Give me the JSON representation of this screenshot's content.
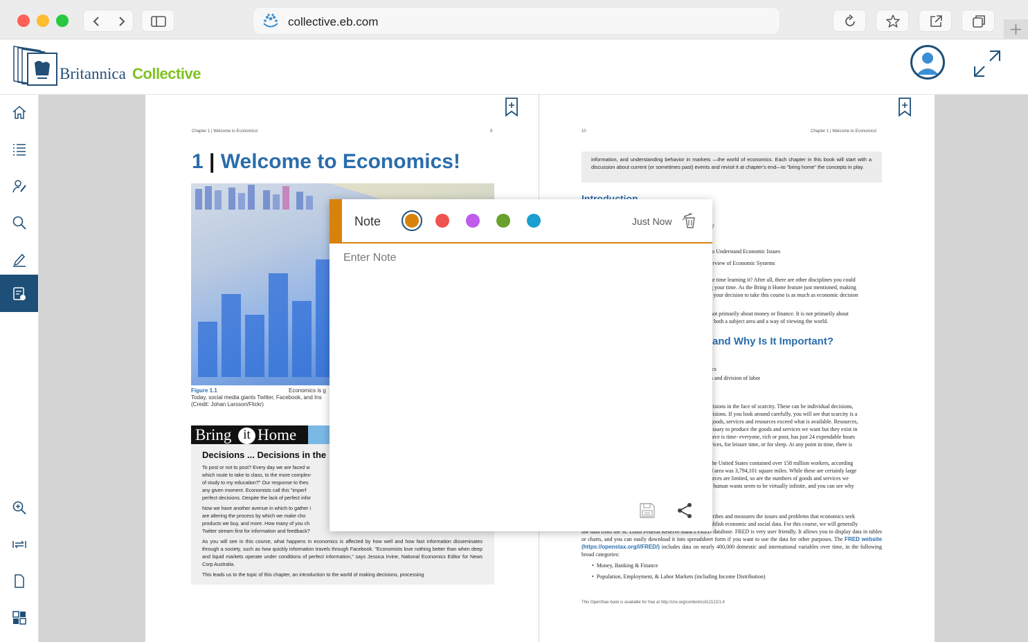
{
  "browser": {
    "url": "collective.eb.com"
  },
  "app": {
    "brand_name": "Britannica",
    "brand_product": "Collective"
  },
  "sidebar": {
    "items": [
      {
        "name": "home",
        "icon": "home-icon"
      },
      {
        "name": "contents",
        "icon": "list-icon"
      },
      {
        "name": "activity",
        "icon": "person-pen-icon"
      },
      {
        "name": "search",
        "icon": "search-icon"
      },
      {
        "name": "annotate",
        "icon": "pencil-icon"
      },
      {
        "name": "notes",
        "icon": "notes-icon",
        "active": true
      },
      {
        "name": "zoom",
        "icon": "zoom-in-icon"
      },
      {
        "name": "fit-width",
        "icon": "fit-width-icon"
      },
      {
        "name": "single-page",
        "icon": "page-icon"
      },
      {
        "name": "thumbnails",
        "icon": "grid-icon"
      }
    ]
  },
  "left_page": {
    "running_head": "Chapter 1 | Welcome to Economics!",
    "page_number": "9",
    "chapter_number": "1",
    "chapter_title": "Welcome to Economics!",
    "figure_label": "Figure 1.1",
    "figure_caption_1": "Economics is g",
    "figure_caption_2": "Today, social media giants Twitter, Facebook, and Ins",
    "figure_credit": "(Credit: Johan Larsson/Flickr)",
    "feature_banner_1": "Bring",
    "feature_banner_2": "it",
    "feature_banner_3": "Home",
    "feature_heading": "Decisions ... Decisions in the",
    "feature_paragraphs": [
      "To post or not to post? Every day we are faced w",
      "which route to take to class, to the more complex-",
      "of study to my education?\" Our response to thes",
      "any given moment. Economists call this \"imperf",
      "perfect decisions. Despite the lack of perfect infor",
      "Now we have another avenue in which to gather i",
      "are altering the process by which we make cho",
      "products we buy, and more. How many of you ch",
      "Twitter stream first for information and feedback?"
    ],
    "feature_full_para_1": "As you will see in this course, what happens in economics is affected by how well and how fast information disseminates through a society, such as how quickly information travels through Facebook. \"Economists love nothing better than when deep and liquid markets operate under conditions of perfect information,\" says Jessica Irvine, National Economics Editor for News Corp Australia.",
    "feature_full_para_2": "This leads us to the topic of this chapter, an introduction to the world of making decisions, processing"
  },
  "right_page": {
    "page_number": "10",
    "running_head": "Chapter 1 | Welcome to Economics!",
    "intro_text": "information, and understanding behavior in markets —the world of economics. Each chapter in this book will start with a discussion about current (or sometimes past) events and revisit it at chapter's end—to \"bring home\" the concepts in play.",
    "section_heading": "Introduction",
    "visible_fragments": [
      "t?",
      "to Understand Economic Issues",
      "erview of Economic Systems",
      "ur time learning it? After all, there are other disciplines you could",
      "g your time. As the Bring it Home feature just mentioned, making",
      "l your decision to take this course is as much as economic decision",
      "not primarily about money or finance. It is not primarily about",
      "s both a subject area and a way of viewing the world.",
      "ics",
      "n and division of labor",
      "cisions in the face of scarcity. These can be individual decisions,",
      "cisions. If you look around carefully, you will see that scarcity is a",
      "goods, services and resources exceed what is available. Resources,",
      "essary to produce the goods and services we want but they exist in",
      "urce is time- everyone, rich or poor, has just 24 expendable hours",
      "vices, for leisure time, or for sleep. At any point in time, there is",
      "the United States contained over 158 million workers, according",
      "d area was 3,794,101 square miles. While these are certainly large",
      "urces are limited, so are the numbers of goods and services we",
      "t human wants seem to be virtually infinite, and you can see why",
      "cribes and measures the issues and problems that economics seek",
      "ublish economic and social data. For this course, we will generally"
    ],
    "section_heading_2": "and Why Is It Important?",
    "bottom_line_1": "use data from the St. Louis Federal Reserve Bank's FRED database. FRED is very user friendly. It allows you to display data in tables or charts, and you can easily download it into spreadsheet form if you want to use the data for other purposes. The",
    "bottom_link": "FRED website (https://openstax.org/l/FRED/)",
    "bottom_line_2": "includes data on nearly 400,000 domestic and international variables over time, in the following broad categories:",
    "bullets": [
      "Money, Banking & Finance",
      "Population, Employment, & Labor Markets (including Income Distribution)"
    ],
    "footer": "This OpenStax book is available for free at http://cnx.org/content/col12122/1.4"
  },
  "note_popup": {
    "title": "Note",
    "timestamp": "Just Now",
    "placeholder": "Enter Note",
    "value": "",
    "colors": [
      "#d9820b",
      "#ef5350",
      "#c05bea",
      "#6aa02c",
      "#1a9fd0"
    ],
    "selected_color": "#d9820b"
  }
}
